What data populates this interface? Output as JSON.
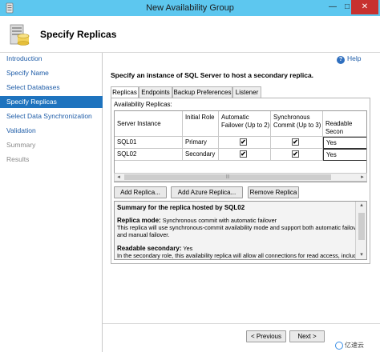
{
  "window": {
    "title": "New Availability Group",
    "minimize": "—",
    "maximize": "□",
    "close": "✕"
  },
  "header": {
    "title": "Specify Replicas"
  },
  "sidebar": {
    "items": [
      {
        "label": "Introduction",
        "state": "normal"
      },
      {
        "label": "Specify Name",
        "state": "normal"
      },
      {
        "label": "Select Databases",
        "state": "normal"
      },
      {
        "label": "Specify Replicas",
        "state": "active"
      },
      {
        "label": "Select Data Synchronization",
        "state": "normal"
      },
      {
        "label": "Validation",
        "state": "normal"
      },
      {
        "label": "Summary",
        "state": "disabled"
      },
      {
        "label": "Results",
        "state": "disabled"
      }
    ]
  },
  "help": {
    "label": "Help",
    "icon": "help-icon"
  },
  "instruction": "Specify an instance of SQL Server to host a secondary replica.",
  "tabs": [
    "Replicas",
    "Endpoints",
    "Backup Preferences",
    "Listener"
  ],
  "replicas": {
    "label": "Availability Replicas:",
    "columns": [
      "Server Instance",
      "Initial Role",
      "Automatic Failover (Up to 2)",
      "Synchronous Commit (Up to 3)",
      "Readable Secon"
    ],
    "rows": [
      {
        "server": "SQL01",
        "role": "Primary",
        "auto_failover": true,
        "sync_commit": true,
        "readable": "Yes"
      },
      {
        "server": "SQL02",
        "role": "Secondary",
        "auto_failover": true,
        "sync_commit": true,
        "readable": "Yes"
      }
    ],
    "check_glyph": "✔"
  },
  "buttons": {
    "add_replica": "Add Replica...",
    "add_azure_replica": "Add Azure Replica...",
    "remove_replica": "Remove Replica",
    "previous": "< Previous",
    "next": "Next >"
  },
  "summary": {
    "title": "Summary for the replica hosted by SQL02",
    "replica_mode_label": "Replica mode:",
    "replica_mode_value": "Synchronous commit with automatic failover",
    "replica_mode_desc_1": "This replica will use synchronous-commit availability mode and support both automatic failover",
    "replica_mode_desc_2": "and manual failover.",
    "readable_label": "Readable secondary:",
    "readable_value": "Yes",
    "readable_desc": "In the secondary role, this availability replica will allow all connections for read access, including"
  },
  "watermark": "亿速云",
  "colors": {
    "title_bar": "#5dc7ef",
    "active_nav": "#1e73be",
    "link": "#1f5da8",
    "close_button": "#c7312f"
  }
}
